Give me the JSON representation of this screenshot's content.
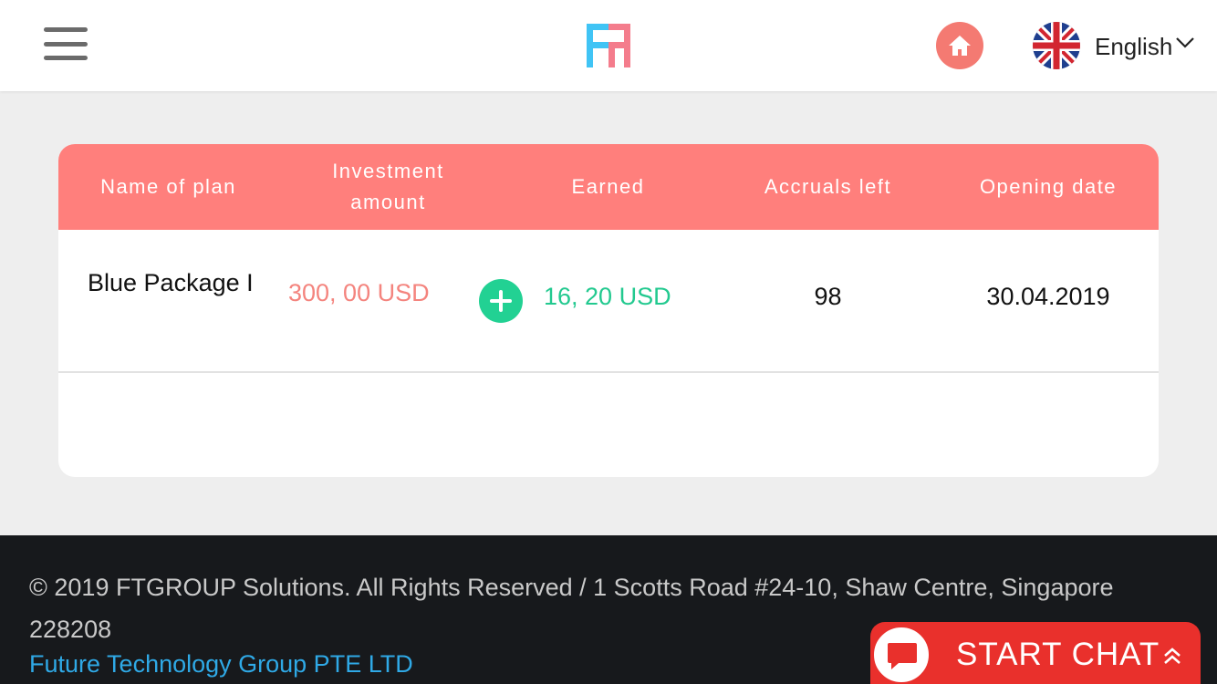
{
  "header": {
    "menu_icon": "hamburger-menu-icon",
    "logo_icon": "ft-logo",
    "home_icon": "home-icon",
    "flag_icon": "uk-flag-icon",
    "language": "English",
    "chevron_icon": "chevron-down-icon"
  },
  "table": {
    "columns": [
      "Name of plan",
      "Investment amount",
      "Earned",
      "Accruals left",
      "Opening date"
    ],
    "rows": [
      {
        "name": "Blue Package I",
        "investment": "300, 00 USD",
        "earned": "16, 20 USD",
        "accruals_left": "98",
        "opening_date": "30.04.2019"
      }
    ]
  },
  "footer": {
    "copyright": "© 2019 FTGROUP Solutions. All Rights Reserved / 1 Scotts Road #24-10, Shaw Centre, Singapore 228208",
    "company_link": "Future Technology Group PTE LTD"
  },
  "chat": {
    "label": "START CHAT",
    "icon": "chat-bubble-icon",
    "arrow_icon": "double-chevron-up-icon"
  },
  "colors": {
    "header_accent": "#ff7f7c",
    "investment_text": "#f4847e",
    "earned_text": "#22c98f",
    "plus_button": "#22d193",
    "home_button": "#f47a72",
    "footer_bg": "#17191c",
    "link": "#2fa9e6",
    "chat_bg": "#e9302c"
  }
}
